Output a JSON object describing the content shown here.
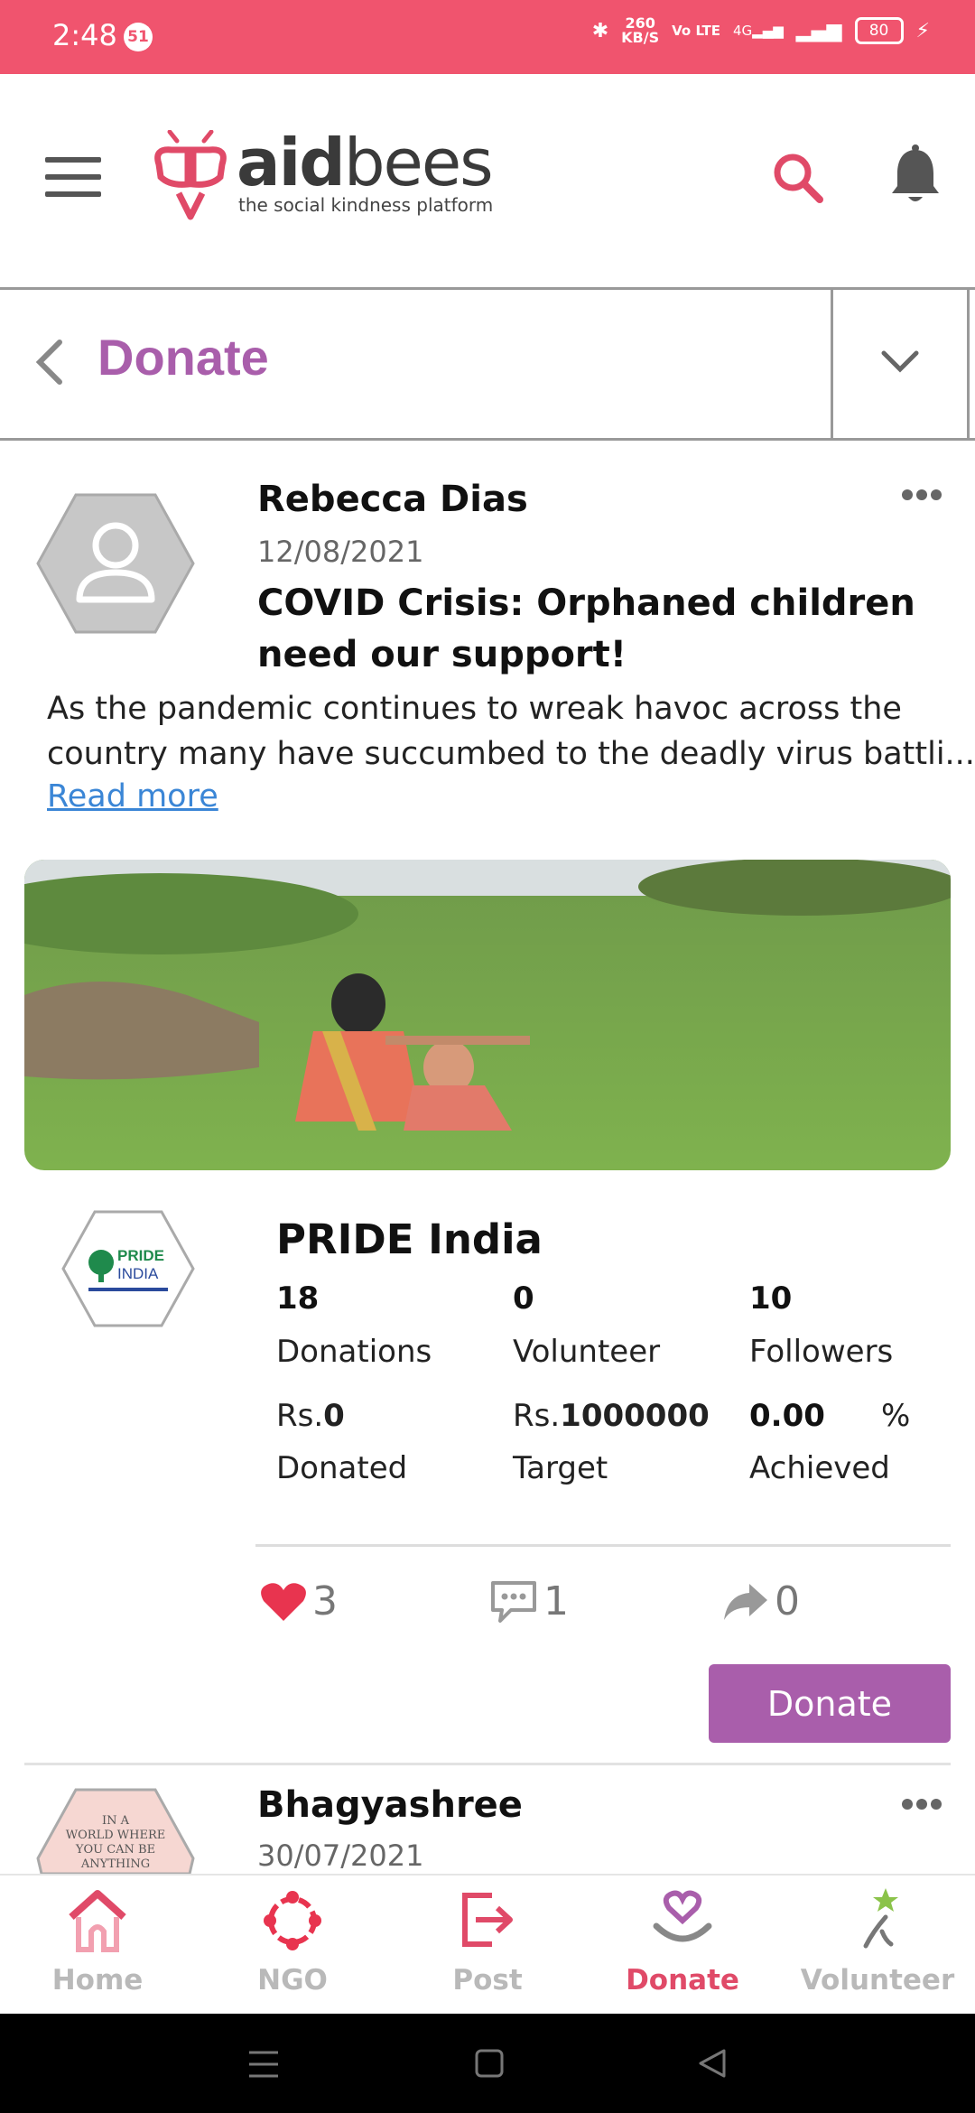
{
  "status_bar": {
    "time": "2:48",
    "notification_count": "51",
    "net_speed": "260\nKB/S",
    "network": "Vo LTE",
    "signal": "4G",
    "battery": "80"
  },
  "header": {
    "logo_text_bold": "aid",
    "logo_text_light": "bees",
    "tagline": "the social kindness platform"
  },
  "page": {
    "title": "Donate"
  },
  "post": {
    "author": "Rebecca Dias",
    "date": "12/08/2021",
    "title": "COVID Crisis: Orphaned children need our support!",
    "body_line1": "As the pandemic continues to wreak havoc across the",
    "body_line2": "country many have succumbed to the deadly virus battli...",
    "read_more": "Read more"
  },
  "ngo": {
    "name": "PRIDE India",
    "logo_text": "PRIDE INDIA",
    "stats": [
      {
        "value": "18",
        "label": "Donations"
      },
      {
        "value": "0",
        "label": "Volunteer"
      },
      {
        "value": "10",
        "label": "Followers"
      }
    ],
    "money": {
      "donated_prefix": "Rs.",
      "donated_value": "0",
      "donated_label": "Donated",
      "target_prefix": "Rs.",
      "target_value": "1000000",
      "target_label": "Target",
      "achieved_value": "0.00",
      "achieved_unit": "%",
      "achieved_label": "Achieved"
    }
  },
  "reactions": {
    "likes": "3",
    "comments": "1",
    "shares": "0"
  },
  "donate_button": "Donate",
  "next_post": {
    "author": "Bhagyashree",
    "date": "30/07/2021",
    "avatar_text": "IN A WORLD WHERE YOU CAN BE ANYTHING"
  },
  "bottom_nav": [
    {
      "label": "Home",
      "icon": "home-icon"
    },
    {
      "label": "NGO",
      "icon": "ngo-icon"
    },
    {
      "label": "Post",
      "icon": "post-icon"
    },
    {
      "label": "Donate",
      "icon": "donate-icon",
      "active": true
    },
    {
      "label": "Volunteer",
      "icon": "volunteer-icon"
    }
  ],
  "colors": {
    "status_bar": "#f0546e",
    "brand_purple": "#a95eab",
    "brand_red": "#e04a68",
    "link": "#3b86d6"
  }
}
